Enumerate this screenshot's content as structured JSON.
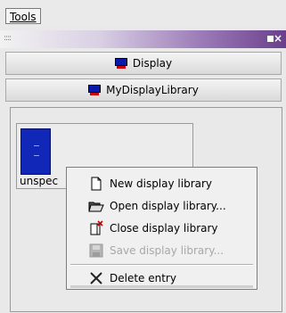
{
  "menubar": {
    "tools_label": "Tools"
  },
  "titlebar": {
    "grip": "::::",
    "close_symbol": "×"
  },
  "tabs": [
    {
      "label": "Display",
      "icon": "monitor-icon"
    },
    {
      "label": "MyDisplayLibrary",
      "icon": "monitor-icon"
    }
  ],
  "library": {
    "item_label": "unspec"
  },
  "context_menu": {
    "items": [
      {
        "label": "New display library",
        "icon": "new-document-icon",
        "enabled": true
      },
      {
        "label": "Open display library...",
        "icon": "open-folder-icon",
        "enabled": true
      },
      {
        "label": "Close display library",
        "icon": "close-document-icon",
        "enabled": true
      },
      {
        "label": "Save display library...",
        "icon": "save-disk-icon",
        "enabled": false
      },
      {
        "label": "Delete entry",
        "icon": "delete-x-icon",
        "enabled": true
      }
    ]
  },
  "colors": {
    "title_gradient_end": "#6a3f8c",
    "monitor_screen": "#0a1aa8",
    "monitor_stand": "#cc0000"
  }
}
